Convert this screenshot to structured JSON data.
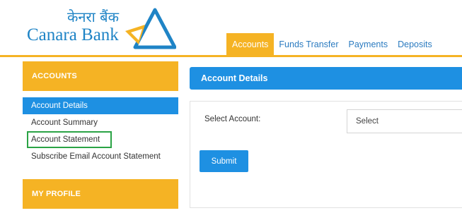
{
  "brand": {
    "name_hindi": "केनरा बैंक",
    "name_english": "Canara Bank",
    "primary_color": "#1f84c6",
    "accent_color": "#f5b324"
  },
  "tabs": [
    {
      "label": "Accounts",
      "active": true
    },
    {
      "label": "Funds Transfer",
      "active": false
    },
    {
      "label": "Payments",
      "active": false
    },
    {
      "label": "Deposits",
      "active": false
    }
  ],
  "sidebar": {
    "accounts_heading": "ACCOUNTS",
    "items": [
      {
        "label": "Account Details",
        "active": true
      },
      {
        "label": "Account Summary",
        "active": false
      },
      {
        "label": "Account Statement",
        "highlighted": true
      },
      {
        "label": "Subscribe Email Account Statement",
        "active": false
      }
    ],
    "profile_heading": "MY PROFILE"
  },
  "main": {
    "title": "Account Details",
    "select_label": "Select Account:",
    "select_value": "Select",
    "submit_label": "Submit"
  },
  "colors": {
    "active_blue": "#1e90e2",
    "highlight_green": "#2aa345"
  }
}
